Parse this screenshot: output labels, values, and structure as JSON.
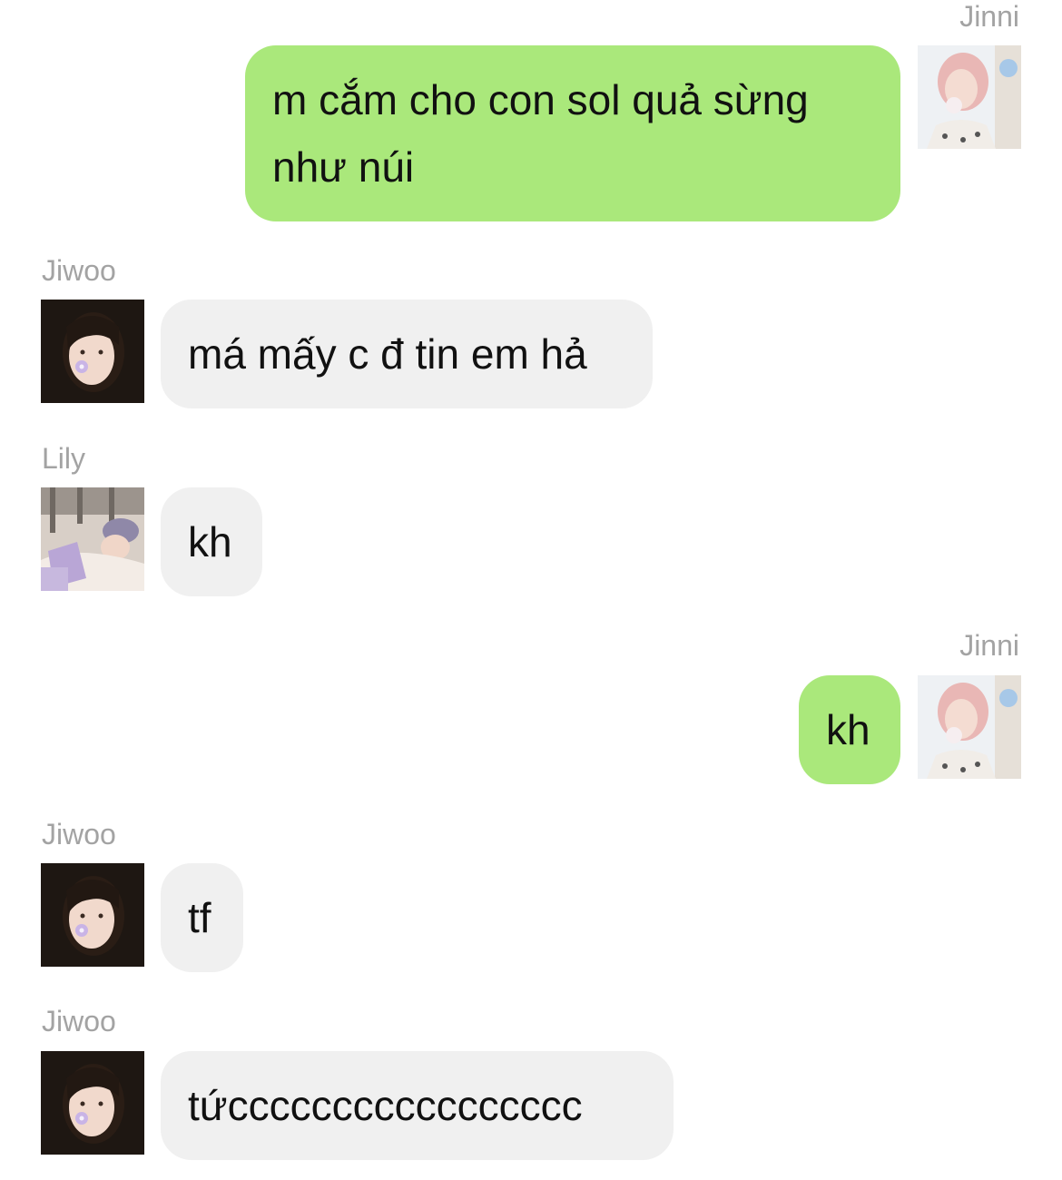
{
  "colors": {
    "outgoing_bubble": "#aae87b",
    "incoming_bubble": "#f0f0f0",
    "sender_name": "#a3a3a3",
    "text": "#111111"
  },
  "messages": [
    {
      "sender": "Jinni",
      "direction": "outgoing",
      "text": "m cắm cho con sol quả sừng như núi",
      "avatar": "jinni-avatar"
    },
    {
      "sender": "Jiwoo",
      "direction": "incoming",
      "text": "má mấy c đ tin em hả",
      "avatar": "jiwoo-avatar"
    },
    {
      "sender": "Lily",
      "direction": "incoming",
      "text": "kh",
      "avatar": "lily-avatar"
    },
    {
      "sender": "Jinni",
      "direction": "outgoing",
      "text": "kh",
      "avatar": "jinni-avatar"
    },
    {
      "sender": "Jiwoo",
      "direction": "incoming",
      "text": "tf",
      "avatar": "jiwoo-avatar"
    },
    {
      "sender": "Jiwoo",
      "direction": "incoming",
      "text": "tứccccccccccccccccc",
      "avatar": "jiwoo-avatar"
    }
  ]
}
